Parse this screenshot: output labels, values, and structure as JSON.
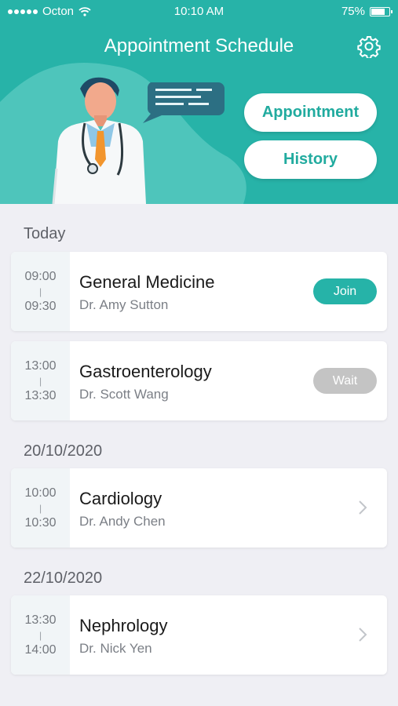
{
  "status_bar": {
    "carrier": "Octon",
    "time": "10:10 AM",
    "battery": "75%"
  },
  "header": {
    "title": "Appointment Schedule",
    "buttons": {
      "appointment": "Appointment",
      "history": "History"
    }
  },
  "sections": [
    {
      "label": "Today",
      "items": [
        {
          "start": "09:00",
          "sep": "|",
          "end": "09:30",
          "department": "General Medicine",
          "doctor": "Dr. Amy Sutton",
          "action": "Join"
        },
        {
          "start": "13:00",
          "sep": "|",
          "end": "13:30",
          "department": "Gastroenterology",
          "doctor": "Dr. Scott Wang",
          "action": "Wait"
        }
      ]
    },
    {
      "label": "20/10/2020",
      "items": [
        {
          "start": "10:00",
          "sep": "|",
          "end": "10:30",
          "department": "Cardiology",
          "doctor": "Dr. Andy Chen"
        }
      ]
    },
    {
      "label": "22/10/2020",
      "items": [
        {
          "start": "13:30",
          "sep": "|",
          "end": "14:00",
          "department": "Nephrology",
          "doctor": "Dr. Nick Yen"
        }
      ]
    }
  ],
  "colors": {
    "teal": "#27b3a8",
    "wait_gray": "#c4c4c4",
    "background": "#efeff4"
  },
  "icons": [
    "signal-dots-icon",
    "wifi-icon",
    "battery-icon",
    "gear-icon",
    "doctor-illustration",
    "speech-bubble-icon",
    "chevron-right-icon"
  ]
}
